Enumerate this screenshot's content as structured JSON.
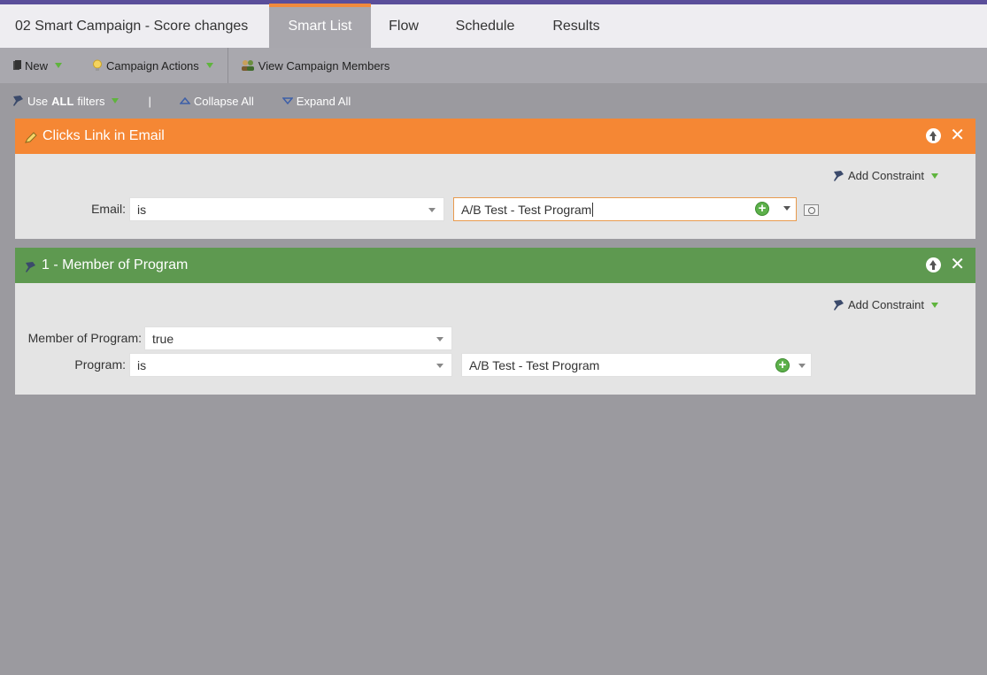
{
  "tabs": {
    "title": "02 Smart Campaign - Score changes",
    "items": [
      "Smart List",
      "Flow",
      "Schedule",
      "Results"
    ]
  },
  "toolbar": {
    "new_label": "New",
    "campaign_actions_label": "Campaign Actions",
    "view_members_label": "View Campaign Members"
  },
  "filterbar": {
    "use_prefix": "Use",
    "use_bold": "ALL",
    "use_suffix": "filters",
    "separator": "|",
    "collapse_label": "Collapse All",
    "expand_label": "Expand All"
  },
  "filters": [
    {
      "title": "Clicks Link in Email",
      "color": "#f58734",
      "add_constraint": "Add Constraint",
      "rows": [
        {
          "label": "Email:",
          "operator": "is",
          "value": "A/B Test - Test Program"
        }
      ]
    },
    {
      "title": "1 - Member of Program",
      "color": "#5e9950",
      "add_constraint": "Add Constraint",
      "rows": [
        {
          "label": "Member of Program:",
          "operator": "true"
        },
        {
          "label": "Program:",
          "operator": "is",
          "value": "A/B Test - Test Program"
        }
      ]
    }
  ],
  "colors": {
    "accent_tab": "#f08a3c",
    "top_stripe": "#5a4e9a",
    "background": "#9b9a9f"
  }
}
